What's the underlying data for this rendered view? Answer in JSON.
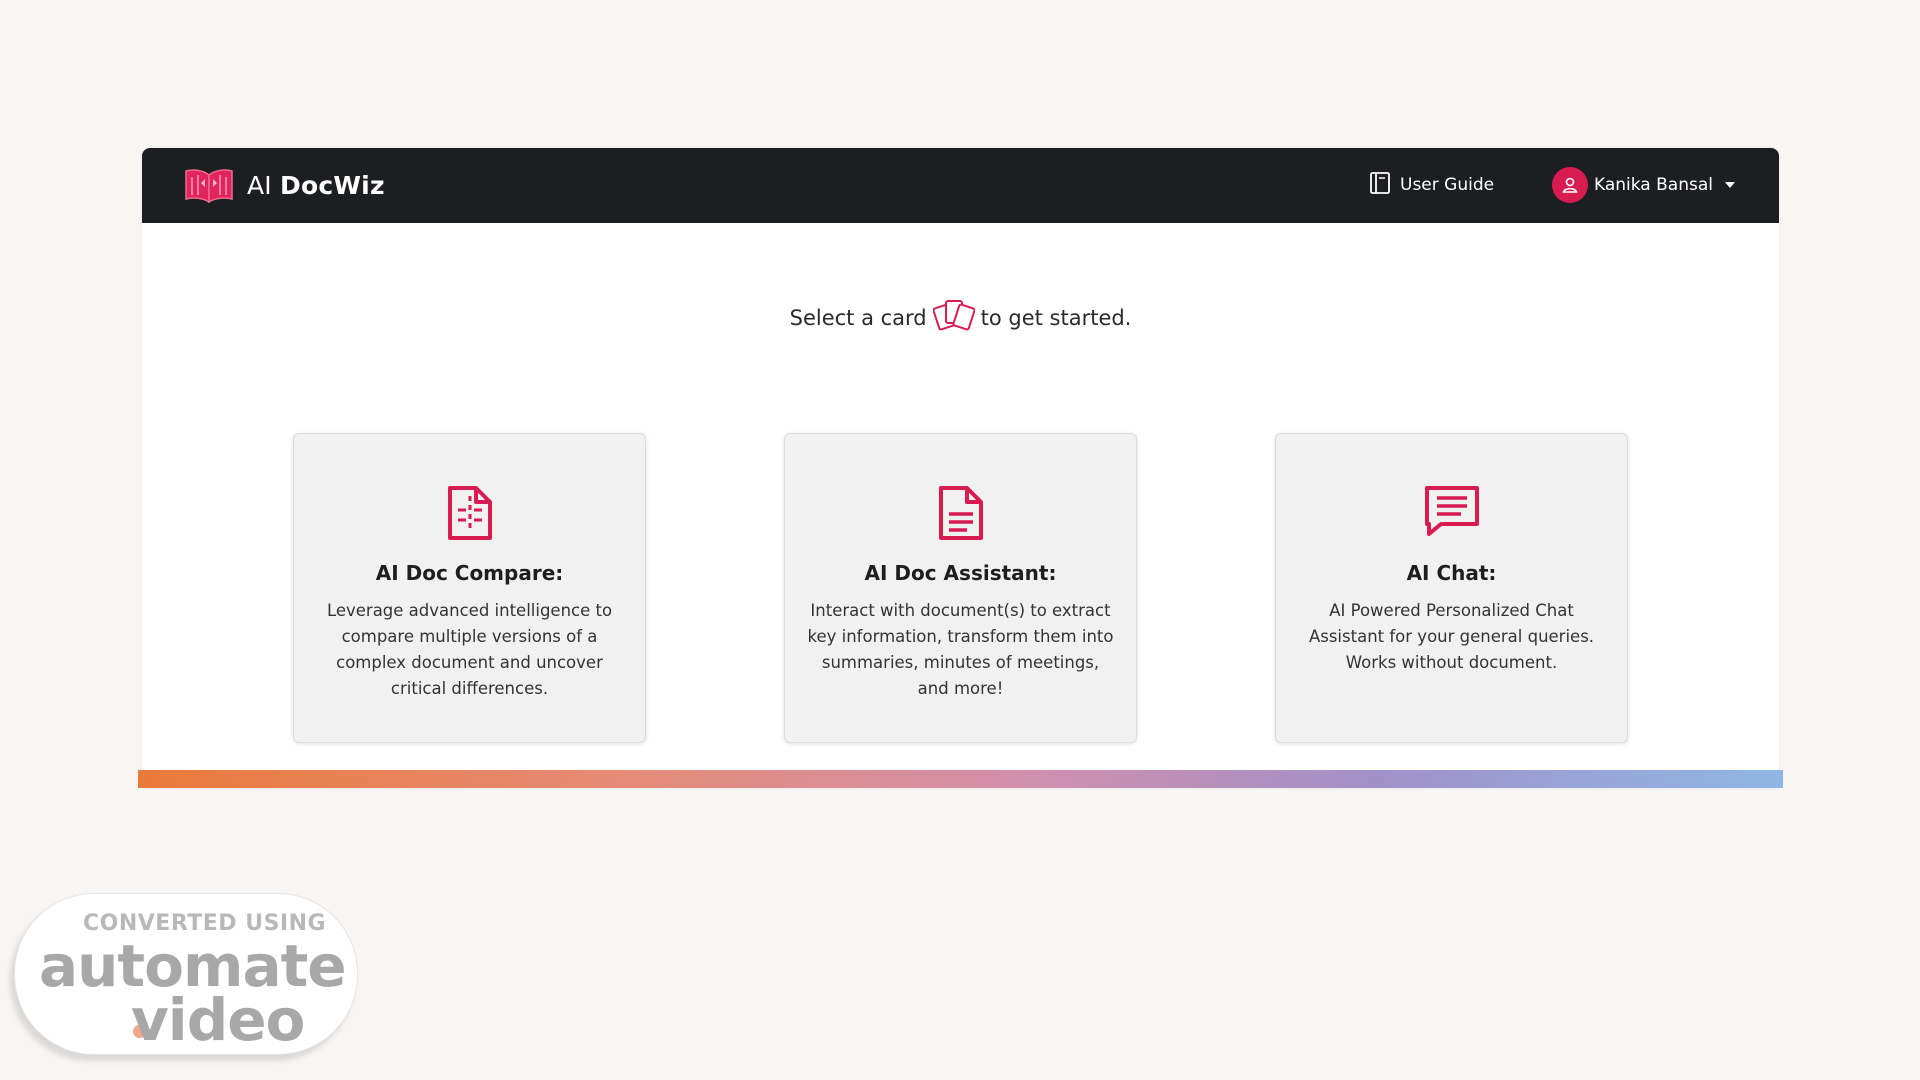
{
  "brand": {
    "prefix": "AI",
    "name": "DocWiz"
  },
  "nav": {
    "user_guide_label": "User Guide",
    "user_name": "Kanika Bansal"
  },
  "prompt": {
    "before": "Select a card",
    "after": "to get started."
  },
  "cards": [
    {
      "title": "AI Doc Compare:",
      "description": "Leverage advanced intelligence to compare multiple versions of a complex document and uncover critical differences.",
      "icon": "file-compare-icon"
    },
    {
      "title": "AI Doc Assistant:",
      "description": "Interact with document(s) to extract key information, transform them into summaries, minutes of meetings, and more!",
      "icon": "file-text-icon"
    },
    {
      "title": "AI Chat:",
      "description": "AI Powered Personalized Chat Assistant for your general queries. Works without document.",
      "icon": "chat-icon"
    }
  ],
  "watermark": {
    "line1": "CONVERTED USING",
    "line2": "automate",
    "line3": "video"
  },
  "colors": {
    "accent": "#d81b50",
    "navbar": "#1c1e22",
    "card_bg": "#f1f1f1"
  }
}
